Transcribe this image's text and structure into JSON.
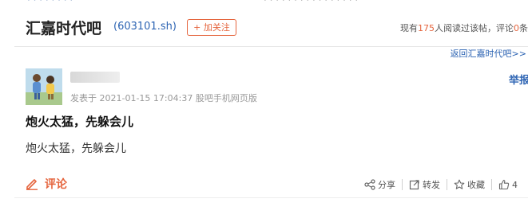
{
  "header": {
    "bar_name": "汇嘉时代吧",
    "stock_code": "(603101.sh)",
    "follow_label": "+ 加关注",
    "readers_prefix": "现有",
    "readers_count": "175",
    "readers_mid": "人阅读过该帖，评论",
    "comments_count": "0",
    "readers_suffix": "条",
    "back_link": "返回汇嘉时代吧>>"
  },
  "post": {
    "meta": "发表于 2021-01-15 17:04:37 股吧手机网页版",
    "report_label": "举报",
    "title": "炮火太猛，先躲会儿",
    "content": "炮火太猛，先躲会儿"
  },
  "actions": {
    "comment_label": "评论",
    "share_label": "分享",
    "forward_label": "转发",
    "favorite_label": "收藏",
    "like_count": "4"
  },
  "colors": {
    "accent": "#e5653e",
    "link": "#2d64b3"
  }
}
